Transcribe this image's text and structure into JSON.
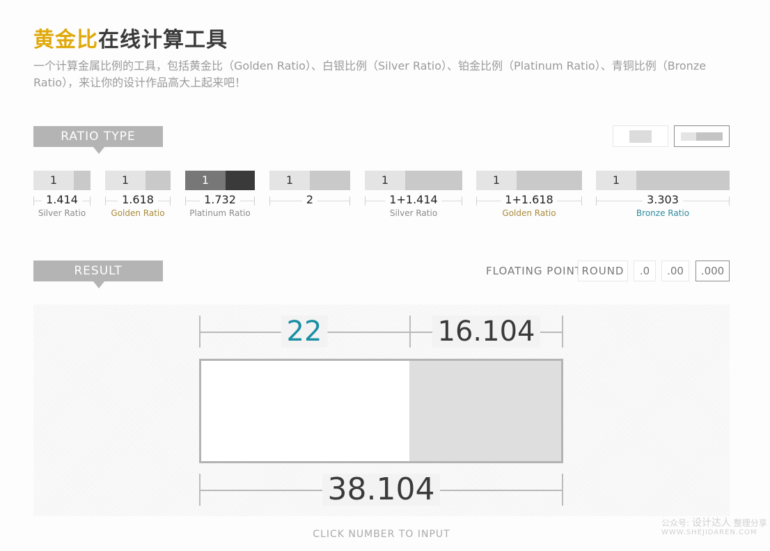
{
  "header": {
    "title_highlight": "黄金比",
    "title_rest": "在线计算工具",
    "description": "一个计算金属比例的工具，包括黄金比（Golden Ratio）、白银比例（Silver Ratio）、铂金比例（Platinum Ratio）、青铜比例（Bronze Ratio），来让你的设计作品高大上起来吧！"
  },
  "ratio_section": {
    "label": "RATIO TYPE",
    "layout_toggles": [
      {
        "name": "single-block-layout",
        "active": false
      },
      {
        "name": "split-block-layout",
        "active": true
      }
    ],
    "ratios": [
      {
        "one": "1",
        "value": "1.414",
        "name": "Silver Ratio",
        "active": false
      },
      {
        "one": "1",
        "value": "1.618",
        "name": "Golden Ratio",
        "active": false
      },
      {
        "one": "1",
        "value": "1.732",
        "name": "Platinum Ratio",
        "active": true
      },
      {
        "one": "1",
        "value": "2",
        "name": "",
        "active": false
      },
      {
        "one": "1",
        "value": "1+1.414",
        "name": "Silver Ratio",
        "active": false
      },
      {
        "one": "1",
        "value": "1+1.618",
        "name": "Golden Ratio",
        "active": false
      },
      {
        "one": "1",
        "value": "3.303",
        "name": "Bronze Ratio",
        "active": false
      }
    ]
  },
  "result_section": {
    "label": "RESULT",
    "floating_point_label": "FLOATING POINT",
    "floating_point_options": [
      "ROUND",
      ".0",
      ".00",
      ".000"
    ],
    "floating_point_selected": ".000",
    "part_a": "22",
    "part_b": "16.104",
    "total": "38.104",
    "hint": "CLICK NUMBER TO INPUT"
  },
  "colors": {
    "gold": "#e0a90b",
    "accent_teal": "#1a8ea3",
    "tab_gray": "#b4b4b4",
    "bronze": "#2e8aa0",
    "golden_label": "#a88a3a"
  },
  "watermark": {
    "line1_prefix": "公众号:",
    "line1_brand": "设计达人",
    "line1_suffix": "整理分享",
    "line2": "WWW.SHEJIDAREN.COM"
  }
}
